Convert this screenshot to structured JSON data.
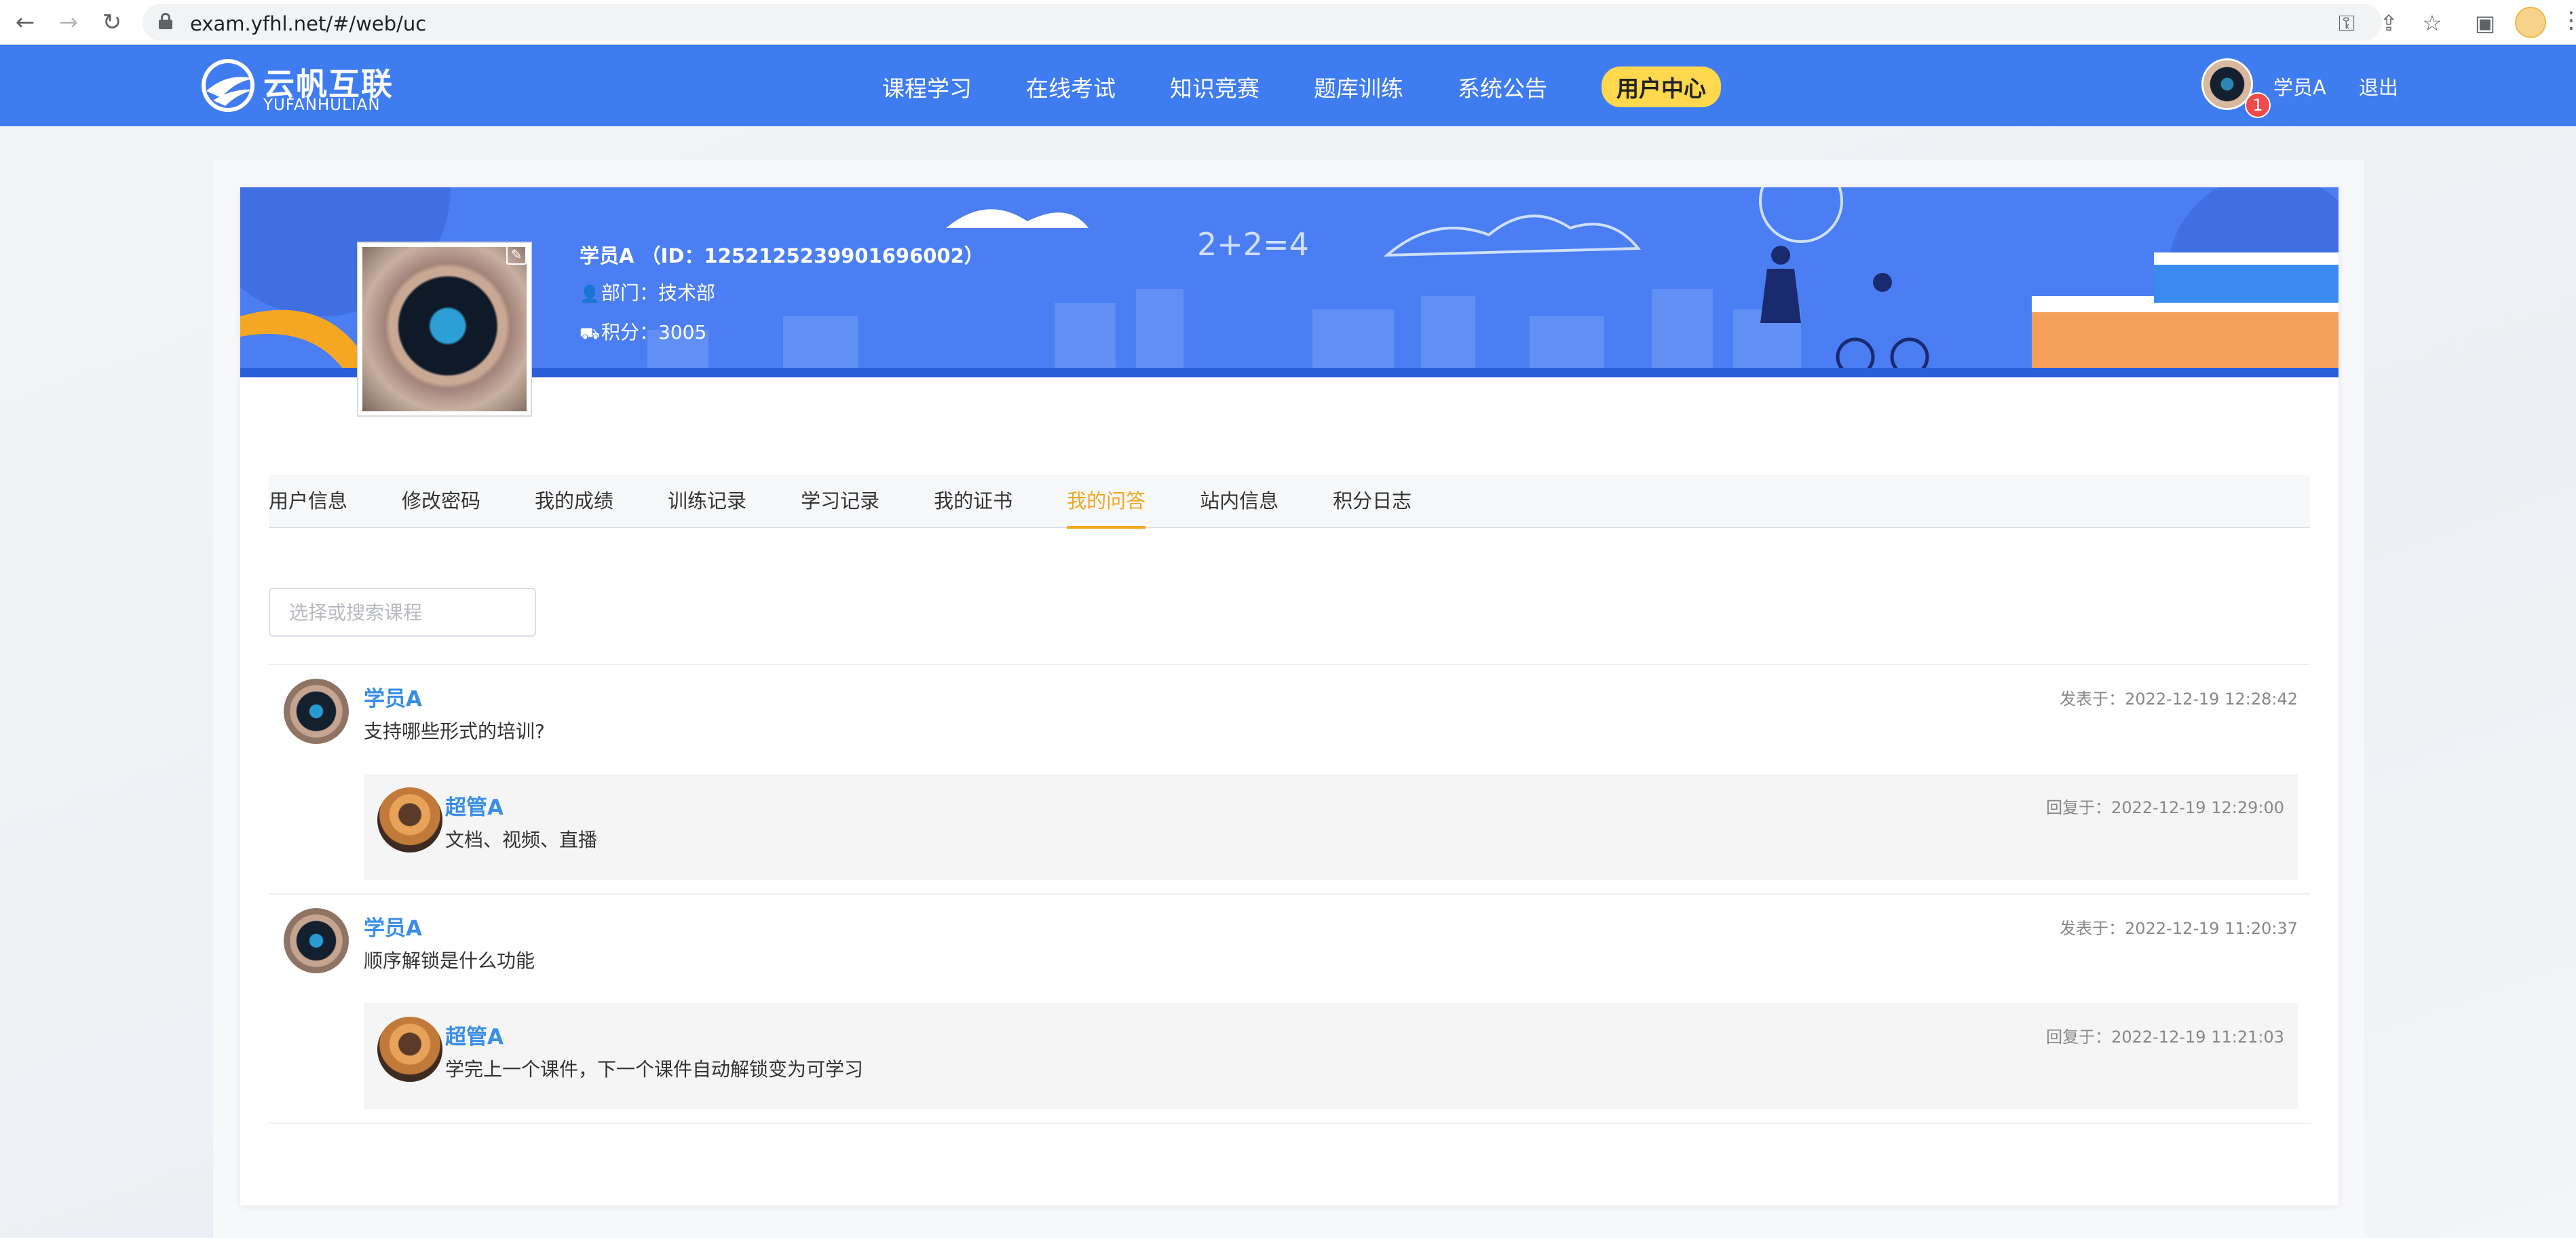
{
  "browser": {
    "url": "exam.yfhl.net/#/web/uc"
  },
  "site": {
    "logo_cn": "云帆互联",
    "logo_en": "YUFANHULIAN",
    "nav": [
      {
        "label": "课程学习"
      },
      {
        "label": "在线考试"
      },
      {
        "label": "知识竞赛"
      },
      {
        "label": "题库训练"
      },
      {
        "label": "系统公告"
      },
      {
        "label": "用户中心",
        "active": true
      }
    ],
    "user_name": "学员A",
    "logout": "退出",
    "notification_count": "1"
  },
  "profile": {
    "name_line": "学员A （ID：1252125239901696002）",
    "department": "部门：技术部",
    "points": "积分：3005"
  },
  "tabs": [
    {
      "label": "用户信息"
    },
    {
      "label": "修改密码"
    },
    {
      "label": "我的成绩"
    },
    {
      "label": "训练记录"
    },
    {
      "label": "学习记录"
    },
    {
      "label": "我的证书"
    },
    {
      "label": "我的问答",
      "active": true
    },
    {
      "label": "站内信息"
    },
    {
      "label": "积分日志"
    }
  ],
  "search": {
    "placeholder": "选择或搜索课程"
  },
  "questions": [
    {
      "author": "学员A",
      "text": "支持哪些形式的培训?",
      "time": "发表于：2022-12-19 12:28:42",
      "reply": {
        "author": "超管A",
        "text": "文档、视频、直播",
        "time": "回复于：2022-12-19 12:29:00"
      }
    },
    {
      "author": "学员A",
      "text": "顺序解锁是什么功能",
      "time": "发表于：2022-12-19 11:20:37",
      "reply": {
        "author": "超管A",
        "text": "学完上一个课件，下一个课件自动解锁变为可学习",
        "time": "回复于：2022-12-19 11:21:03"
      }
    }
  ],
  "colors": {
    "header_blue": "#3f7cf0",
    "active_tab": "#f5a623",
    "name_blue": "#3a8ee6",
    "active_nav_bg": "#ffd84d"
  }
}
